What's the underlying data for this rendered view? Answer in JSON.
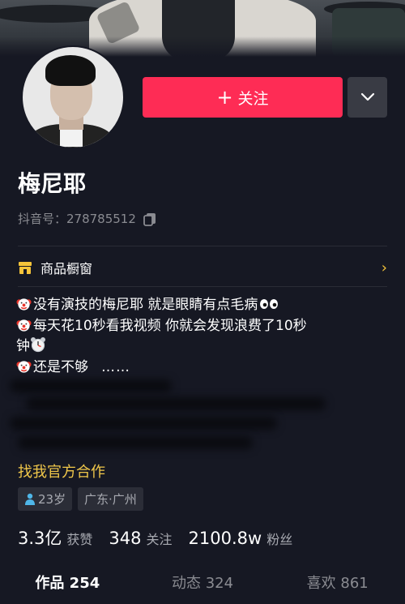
{
  "profile": {
    "follow_label": "关注",
    "name": "梅尼耶",
    "douyin_id": "抖音号：278785512"
  },
  "shop": {
    "label": "商品橱窗"
  },
  "bio": {
    "line1": "没有演技的梅尼耶 就是眼睛有点毛病",
    "line2": "每天花10秒看我视频 你就会发现浪费了10秒",
    "line3": "钟",
    "line4": "还是不够",
    "line4_more": "……"
  },
  "collab": "找我官方合作",
  "tags": {
    "age": "23岁",
    "location": "广东·广州"
  },
  "stats": {
    "likes_value": "3.3亿",
    "likes_label": "获赞",
    "following_value": "348",
    "following_label": "关注",
    "followers_value": "2100.8w",
    "followers_label": "粉丝"
  },
  "tabs": [
    {
      "label": "作品 254"
    },
    {
      "label": "动态 324"
    },
    {
      "label": "喜欢 861"
    }
  ],
  "colors": {
    "accent": "#fe2c55",
    "background": "#161823",
    "gold": "#f0c74a"
  },
  "icons": [
    "plus-icon",
    "chevron-down-icon",
    "copy-icon",
    "shop-icon",
    "chevron-right-icon",
    "clown-emoji-icon",
    "eyes-emoji-icon",
    "alarm-clock-emoji-icon",
    "person-icon"
  ]
}
